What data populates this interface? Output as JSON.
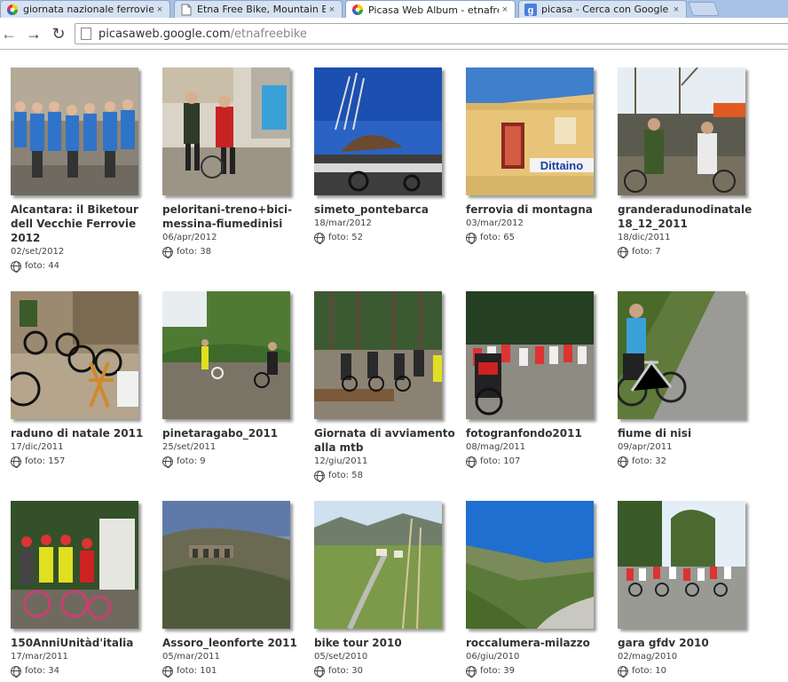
{
  "browser": {
    "tabs": [
      {
        "title": "giornata nazionale ferrovie d",
        "favicon": "picasa-icon",
        "active": false
      },
      {
        "title": "Etna Free Bike, Mountain Bik",
        "favicon": "page-icon",
        "active": false
      },
      {
        "title": "Picasa Web Album - etnafree",
        "favicon": "picasa-icon",
        "active": true
      },
      {
        "title": "picasa - Cerca con Google",
        "favicon": "google-icon",
        "active": false
      }
    ],
    "close_glyph": "×",
    "nav": {
      "back": "←",
      "forward": "→",
      "reload": "↻"
    },
    "url": {
      "host": "picasaweb.google.com",
      "path": "/etnafreebike"
    }
  },
  "albums": [
    {
      "name": "Alcantara: il Biketour dell Vecchie Ferrovie 2012",
      "date": "02/set/2012",
      "count": "foto: 44"
    },
    {
      "name": "peloritani-treno+bici-messina-fiumedinisi",
      "date": "06/apr/2012",
      "count": "foto: 38"
    },
    {
      "name": "simeto_pontebarca",
      "date": "18/mar/2012",
      "count": "foto: 52"
    },
    {
      "name": "ferrovia di montagna",
      "date": "03/mar/2012",
      "count": "foto: 65"
    },
    {
      "name": "granderadunodinatale 18_12_2011",
      "date": "18/dic/2011",
      "count": "foto: 7"
    },
    {
      "name": "raduno di natale 2011",
      "date": "17/dic/2011",
      "count": "foto: 157"
    },
    {
      "name": "pinetaragabo_2011",
      "date": "25/set/2011",
      "count": "foto: 9"
    },
    {
      "name": "Giornata di avviamento alla mtb",
      "date": "12/giu/2011",
      "count": "foto: 58"
    },
    {
      "name": "fotogranfondo2011",
      "date": "08/mag/2011",
      "count": "foto: 107"
    },
    {
      "name": "fiume di nisi",
      "date": "09/apr/2011",
      "count": "foto: 32"
    },
    {
      "name": "150AnniUnitàd'italia",
      "date": "17/mar/2011",
      "count": "foto: 34"
    },
    {
      "name": "Assoro_leonforte 2011",
      "date": "05/mar/2011",
      "count": "foto: 101"
    },
    {
      "name": "bike tour 2010",
      "date": "05/set/2010",
      "count": "foto: 30"
    },
    {
      "name": "roccalumera-milazzo",
      "date": "06/giu/2010",
      "count": "foto: 39"
    },
    {
      "name": "gara gfdv 2010",
      "date": "02/mag/2010",
      "count": "foto: 10"
    }
  ],
  "station_sign": "Dittaino",
  "colors": {
    "tab_strip": "#a8c1e4",
    "name_text": "#333333",
    "meta_text": "#444444"
  }
}
